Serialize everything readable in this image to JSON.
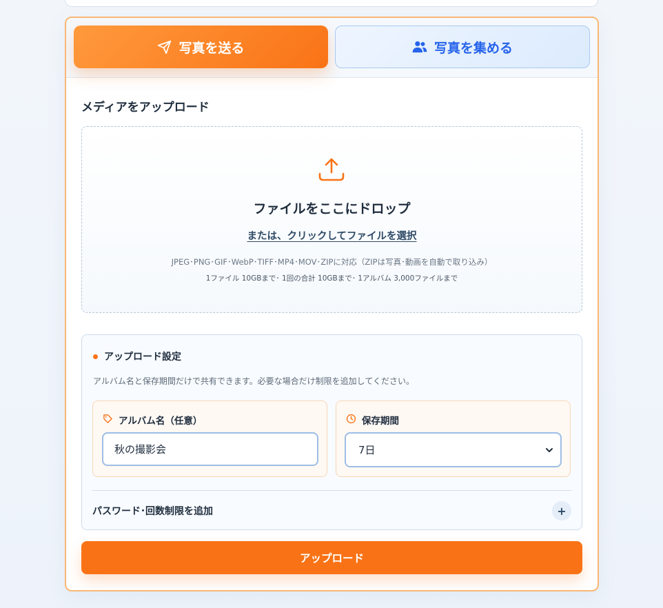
{
  "tabs": {
    "send_label": "写真を送る",
    "collect_label": "写真を集める"
  },
  "upload": {
    "section_title": "メディアをアップロード",
    "drop_title": "ファイルをここにドロップ",
    "drop_link": "または、クリックしてファイルを選択",
    "formats_note": "JPEG･PNG･GIF･WebP･TIFF･MP4･MOV･ZIPに対応（ZIPは写真･動画を自動で取り込み）",
    "limits_note": "1ファイル 10GBまで･ 1回の合計 10GBまで･ 1アルバム 3,000ファイルまで"
  },
  "settings": {
    "title": "アップロード設定",
    "description": "アルバム名と保存期間だけで共有できます。必要な場合だけ制限を追加してください。",
    "album_label": "アルバム名（任意）",
    "album_value": "秋の撮影会",
    "retention_label": "保存期間",
    "retention_value": "7日",
    "password_toggle_label": "パスワード･回数制限を追加",
    "plus_symbol": "+"
  },
  "submit_label": "アップロード",
  "colors": {
    "accent": "#f97316",
    "secondary": "#2563eb"
  }
}
